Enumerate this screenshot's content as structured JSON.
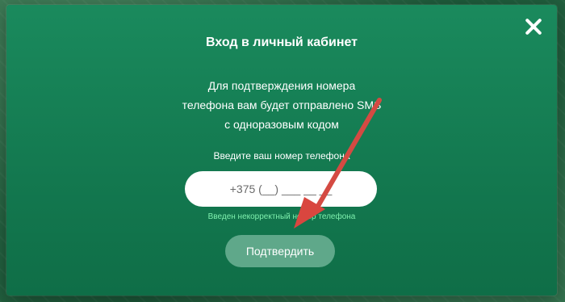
{
  "modal": {
    "title": "Вход в личный кабинет",
    "info_lines": [
      "Для подтверждения номера",
      "телефона вам будет отправлено SMS",
      "с одноразовым кодом"
    ],
    "phone_label": "Введите ваш номер телефона",
    "phone_placeholder": "+375 (__) ___ __ __",
    "error_text": "Введен некорректный номер телефона",
    "confirm_label": "Подтвердить",
    "close_icon": "close-icon"
  },
  "colors": {
    "modal_bg": "#13784f",
    "error": "#7ff0ae",
    "button": "#5fa88a",
    "annotation_arrow": "#d9463f"
  }
}
